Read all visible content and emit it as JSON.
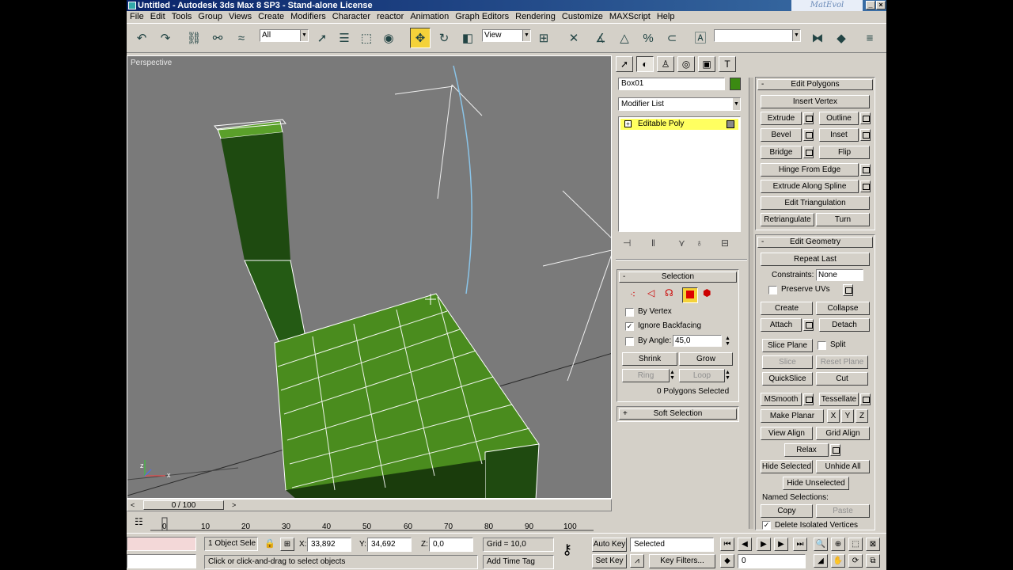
{
  "window": {
    "title": "Untitled - Autodesk 3ds Max 8 SP3 - Stand-alone License",
    "logo": "MatEvol"
  },
  "menu": [
    "File",
    "Edit",
    "Tools",
    "Group",
    "Views",
    "Create",
    "Modifiers",
    "Character",
    "reactor",
    "Animation",
    "Graph Editors",
    "Rendering",
    "Customize",
    "MAXScript",
    "Help"
  ],
  "toolbar": {
    "selection_filter": "All",
    "ref_coord": "View",
    "named_sel": ""
  },
  "viewport": {
    "label": "Perspective"
  },
  "command_panel": {
    "object_name": "Box01",
    "object_color": "#3b8a12",
    "modifier_list": "Modifier List",
    "stack_item": "Editable Poly"
  },
  "selection": {
    "title": "Selection",
    "by_vertex": "By Vertex",
    "ignore_backfacing": "Ignore Backfacing",
    "by_angle": "By Angle:",
    "angle_value": "45,0",
    "shrink": "Shrink",
    "grow": "Grow",
    "ring": "Ring",
    "loop": "Loop",
    "status": "0 Polygons Selected"
  },
  "soft_selection": {
    "title": "Soft Selection"
  },
  "edit_polygons": {
    "title": "Edit Polygons",
    "insert_vertex": "Insert Vertex",
    "extrude": "Extrude",
    "outline": "Outline",
    "bevel": "Bevel",
    "inset": "Inset",
    "bridge": "Bridge",
    "flip": "Flip",
    "hinge": "Hinge From Edge",
    "extrude_spline": "Extrude Along Spline",
    "edit_tri": "Edit Triangulation",
    "retriangulate": "Retriangulate",
    "turn": "Turn"
  },
  "edit_geometry": {
    "title": "Edit Geometry",
    "repeat_last": "Repeat Last",
    "constraints_label": "Constraints:",
    "constraints_value": "None",
    "preserve_uvs": "Preserve UVs",
    "create": "Create",
    "collapse": "Collapse",
    "attach": "Attach",
    "detach": "Detach",
    "slice_plane": "Slice Plane",
    "split": "Split",
    "slice": "Slice",
    "reset_plane": "Reset Plane",
    "quickslice": "QuickSlice",
    "cut": "Cut",
    "msmooth": "MSmooth",
    "tessellate": "Tessellate",
    "make_planar": "Make Planar",
    "x": "X",
    "y": "Y",
    "z": "Z",
    "view_align": "View Align",
    "grid_align": "Grid Align",
    "relax": "Relax",
    "hide_selected": "Hide Selected",
    "unhide_all": "Unhide All",
    "hide_unselected": "Hide Unselected",
    "named_selections": "Named Selections:",
    "copy": "Copy",
    "paste": "Paste",
    "delete_isolated": "Delete Isolated Vertices"
  },
  "timeline": {
    "frame": "0 / 100",
    "ticks": [
      "0",
      "10",
      "20",
      "30",
      "40",
      "50",
      "60",
      "70",
      "80",
      "90",
      "100"
    ]
  },
  "status": {
    "selected": "1 Object Sele",
    "x_label": "X:",
    "x": "33,892",
    "y_label": "Y:",
    "y": "34,692",
    "z_label": "Z:",
    "z": "0,0",
    "grid": "Grid = 10,0",
    "prompt": "Click or click-and-drag to select objects",
    "add_time_tag": "Add Time Tag",
    "auto_key": "Auto Key",
    "set_key": "Set Key",
    "key_mode": "Selected",
    "key_filters": "Key Filters...",
    "frame_field": "0"
  }
}
